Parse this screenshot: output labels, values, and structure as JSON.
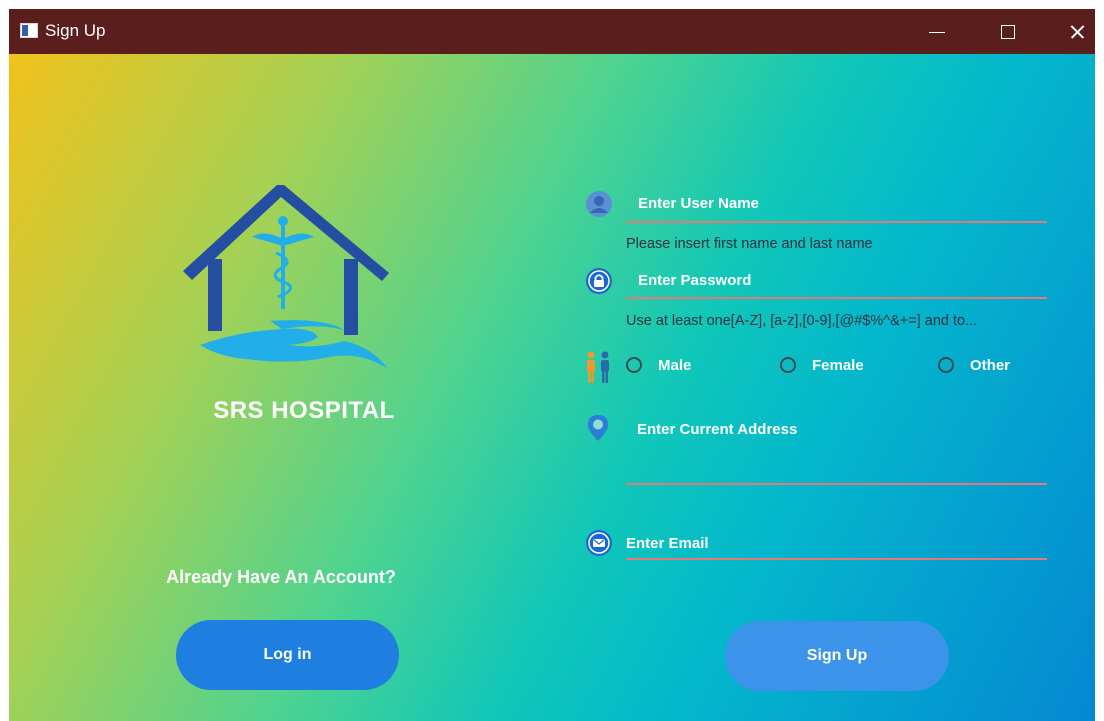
{
  "window": {
    "title": "Sign Up",
    "controls": [
      "minimize-icon",
      "maximize-icon",
      "close-icon"
    ]
  },
  "brand": {
    "name": "SRS  HOSPITAL"
  },
  "left": {
    "account_prompt": "Already Have An Account?",
    "login_label": "Log in"
  },
  "form": {
    "username": {
      "label": "Enter User Name",
      "helper": "Please insert first name and last name",
      "icon": "user-icon"
    },
    "password": {
      "label": "Enter Password",
      "helper": "Use at least one[A-Z], [a-z],[0-9],[@#$%^&+=] and to...",
      "icon": "lock-icon"
    },
    "gender": {
      "icon": "gender-icon",
      "options": [
        {
          "label": "Male",
          "selected": false
        },
        {
          "label": "Female",
          "selected": false
        },
        {
          "label": "Other",
          "selected": false
        }
      ]
    },
    "address": {
      "label": "Enter Current Address",
      "icon": "location-pin-icon"
    },
    "email": {
      "label": "Enter Email",
      "icon": "email-icon"
    },
    "signup_label": "Sign Up"
  },
  "colors": {
    "titlebar": "#5a1f1c",
    "login_button": "#1e7fe0",
    "signup_button": "#3c93ea",
    "logo_blue": "#234ea1",
    "logo_cyan": "#22aee8",
    "field_underline": "#e37a78"
  }
}
